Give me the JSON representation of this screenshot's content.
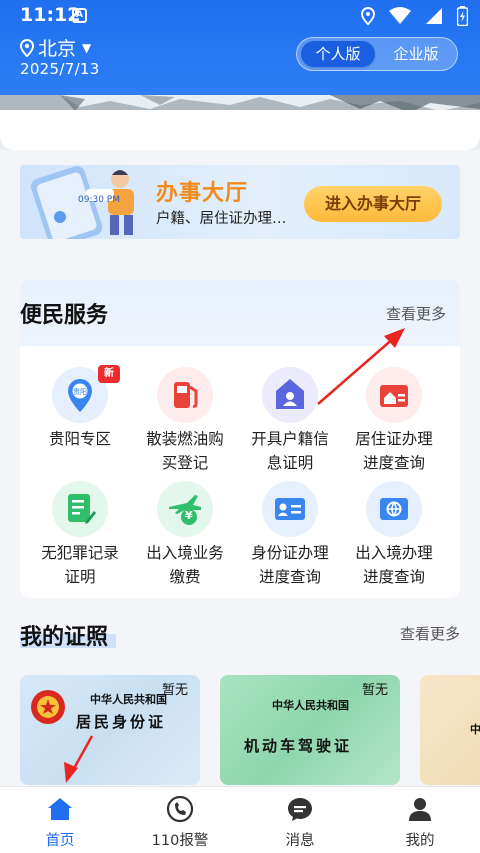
{
  "status_bar": {
    "time": "11:12",
    "badge": "A"
  },
  "header": {
    "city": "北京",
    "date": "2025/7/13",
    "toggle": {
      "personal": "个人版",
      "enterprise": "企业版",
      "selected": "个人版"
    }
  },
  "hall": {
    "title": "办事大厅",
    "subtitle": "户籍、居住证办理…",
    "button": "进入办事大厅",
    "phone_time": "09:30 PM"
  },
  "services": {
    "title": "便民服务",
    "more": "查看更多",
    "items": [
      {
        "line1": "贵阳专区",
        "line2": "",
        "icon": "location-pin-icon",
        "badge": "新",
        "icon_text": "贵阳"
      },
      {
        "line1": "散装燃油购",
        "line2": "买登记",
        "icon": "fuel-pump-icon"
      },
      {
        "line1": "开具户籍信",
        "line2": "息证明",
        "icon": "household-person-icon"
      },
      {
        "line1": "居住证办理",
        "line2": "进度查询",
        "icon": "residence-card-icon"
      },
      {
        "line1": "无犯罪记录",
        "line2": "证明",
        "icon": "document-edit-icon"
      },
      {
        "line1": "出入境业务",
        "line2": "缴费",
        "icon": "plane-yuan-icon",
        "icon_text": "¥"
      },
      {
        "line1": "身份证办理",
        "line2": "进度查询",
        "icon": "id-card-icon"
      },
      {
        "line1": "出入境办理",
        "line2": "进度查询",
        "icon": "passport-globe-icon"
      }
    ]
  },
  "certificates": {
    "title": "我的证照",
    "more": "查看更多",
    "cards": [
      {
        "country": "中华人民共和国",
        "name": "居民身份证",
        "status": "暂无"
      },
      {
        "country": "中华人民共和国",
        "name": "机动车驾驶证",
        "status": "暂无"
      },
      {
        "country": "中"
      }
    ]
  },
  "bottom_nav": {
    "items": [
      {
        "label": "首页",
        "icon": "home-icon",
        "active": true
      },
      {
        "label": "110报警",
        "icon": "phone-icon"
      },
      {
        "label": "消息",
        "icon": "message-icon"
      },
      {
        "label": "我的",
        "icon": "user-icon"
      }
    ]
  },
  "colors": {
    "primary": "#1f6ff0",
    "accent_orange": "#f28a1a",
    "badge_red": "#f02b2b",
    "annotation_red": "#e8251f"
  }
}
